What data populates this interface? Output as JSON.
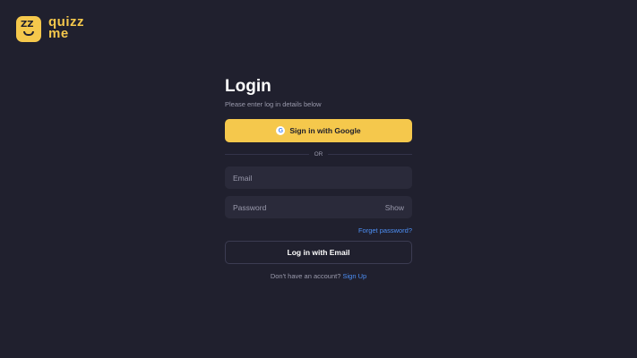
{
  "logo": {
    "mark": "ZZ",
    "line1": "quizz",
    "line2": "me"
  },
  "login": {
    "title": "Login",
    "subtitle": "Please enter log in details below",
    "google_button": "Sign in with Google",
    "google_glyph": "G",
    "divider_text": "OR",
    "email_placeholder": "Email",
    "password_placeholder": "Password",
    "show_label": "Show",
    "forgot_link": "Forget password?",
    "email_button": "Log in with Email",
    "no_account_text": "Don't have an account?",
    "signup_link": "Sign Up"
  },
  "colors": {
    "background": "#20202e",
    "accent": "#f5c84c",
    "link": "#4d8ff5",
    "field": "#2a2a3a"
  }
}
